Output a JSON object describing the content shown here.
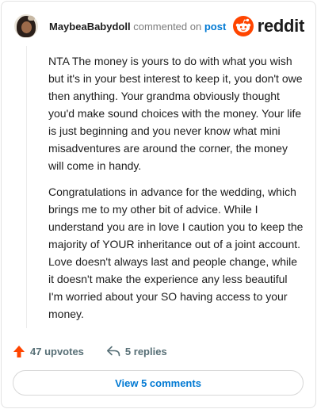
{
  "header": {
    "username": "MaybeaBabydoll",
    "action_text": "commented on",
    "post_link": "post",
    "logo_text": "reddit",
    "avatar_icon": "user-avatar",
    "logo_icon": "reddit-snoo-icon"
  },
  "comment": {
    "paragraphs": [
      "NTA The money is yours to do with what you wish but it's in your best interest to keep it, you don't owe then anything. Your grandma obviously thought you'd make sound choices with the money. Your life is just beginning and you never know what mini misadventures are around the corner, the money will come in handy.",
      "Congratulations in advance for the wedding, which brings me to my other bit of advice. While I understand you are in love I caution you to keep the majority of YOUR inheritance out of a joint account. Love doesn't always last and people change, while it doesn't make the experience any less beautiful I'm worried about your SO having access to your money."
    ]
  },
  "actions": {
    "upvotes": "47 upvotes",
    "replies": "5 replies",
    "upvote_icon": "upvote-arrow-icon",
    "reply_icon": "reply-arrow-icon"
  },
  "view_comments": "View 5 comments",
  "colors": {
    "brand_orange": "#ff4500",
    "link_blue": "#0079d3",
    "muted_text": "#7c7c7c",
    "action_gray": "#576f76"
  }
}
